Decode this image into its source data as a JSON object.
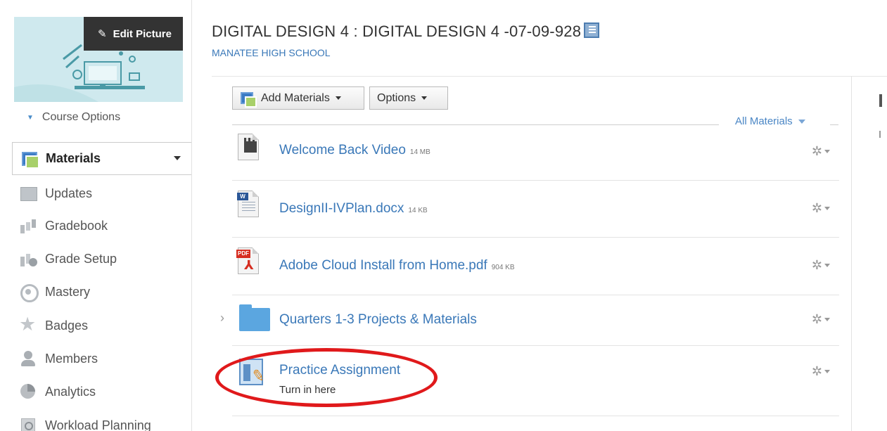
{
  "sidebar": {
    "edit_picture_label": "Edit Picture",
    "course_options_label": "Course Options",
    "items": [
      {
        "label": "Materials",
        "icon": "materials-icon",
        "active": true
      },
      {
        "label": "Updates",
        "icon": "updates-icon"
      },
      {
        "label": "Gradebook",
        "icon": "gradebook-icon"
      },
      {
        "label": "Grade Setup",
        "icon": "grade-setup-icon"
      },
      {
        "label": "Mastery",
        "icon": "mastery-icon"
      },
      {
        "label": "Badges",
        "icon": "badges-icon"
      },
      {
        "label": "Members",
        "icon": "members-icon"
      },
      {
        "label": "Analytics",
        "icon": "analytics-icon"
      },
      {
        "label": "Workload Planning",
        "icon": "workload-planning-icon"
      }
    ]
  },
  "header": {
    "course_title": "DIGITAL DESIGN 4 : DIGITAL DESIGN 4 -07-09-928",
    "school": "MANATEE HIGH SCHOOL"
  },
  "toolbar": {
    "add_materials_label": "Add Materials",
    "options_label": "Options",
    "filter_label": "All Materials"
  },
  "materials": [
    {
      "name": "Welcome Back Video",
      "size": "14 MB",
      "type": "video"
    },
    {
      "name": "DesignII-IVPlan.docx",
      "size": "14 KB",
      "type": "word"
    },
    {
      "name": "Adobe Cloud Install from Home.pdf",
      "size": "904 KB",
      "type": "pdf"
    },
    {
      "name": "Quarters 1-3 Projects & Materials",
      "type": "folder"
    },
    {
      "name": "Practice Assignment",
      "description": "Turn in here",
      "type": "assignment"
    }
  ],
  "colors": {
    "link_blue": "#3a78b8",
    "highlight_red": "#e0191b",
    "edit_picture_bg": "#333333"
  }
}
